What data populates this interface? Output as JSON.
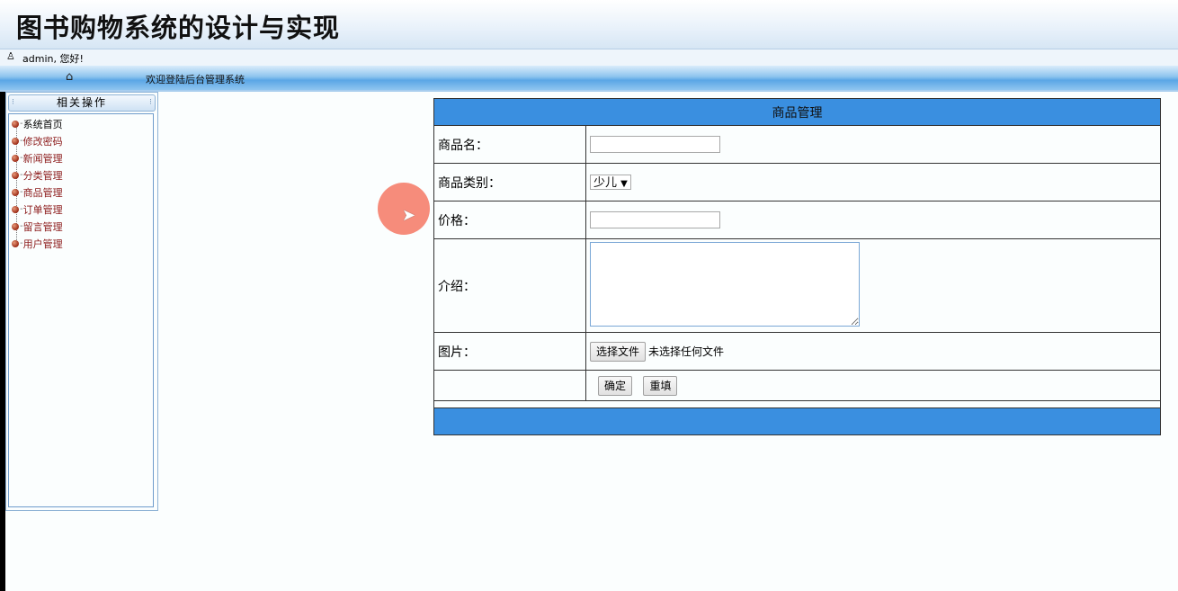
{
  "header": {
    "title": "图书购物系统的设计与实现"
  },
  "userbar": {
    "user_icon": "user-icon",
    "greeting": "admin, 您好!"
  },
  "navbar": {
    "home_icon": "home-icon",
    "welcome": "欢迎登陆后台管理系统"
  },
  "sidebar": {
    "title": "相关操作",
    "items": [
      {
        "label": "系统首页"
      },
      {
        "label": "修改密码"
      },
      {
        "label": "新闻管理"
      },
      {
        "label": "分类管理"
      },
      {
        "label": "商品管理"
      },
      {
        "label": "订单管理"
      },
      {
        "label": "留言管理"
      },
      {
        "label": "用户管理"
      }
    ]
  },
  "form": {
    "title": "商品管理",
    "name_label": "商品名：",
    "name_value": "",
    "category_label": "商品类别：",
    "category_selected": "少儿",
    "price_label": "价格：",
    "price_value": "",
    "intro_label": "介绍：",
    "intro_value": "",
    "image_label": "图片：",
    "choose_file_button": "选择文件",
    "file_status": "未选择任何文件",
    "submit_button": "确定",
    "reset_button": "重填"
  },
  "colors": {
    "table_header": "#3a8fe0",
    "menu_link": "#8b1a1a"
  }
}
